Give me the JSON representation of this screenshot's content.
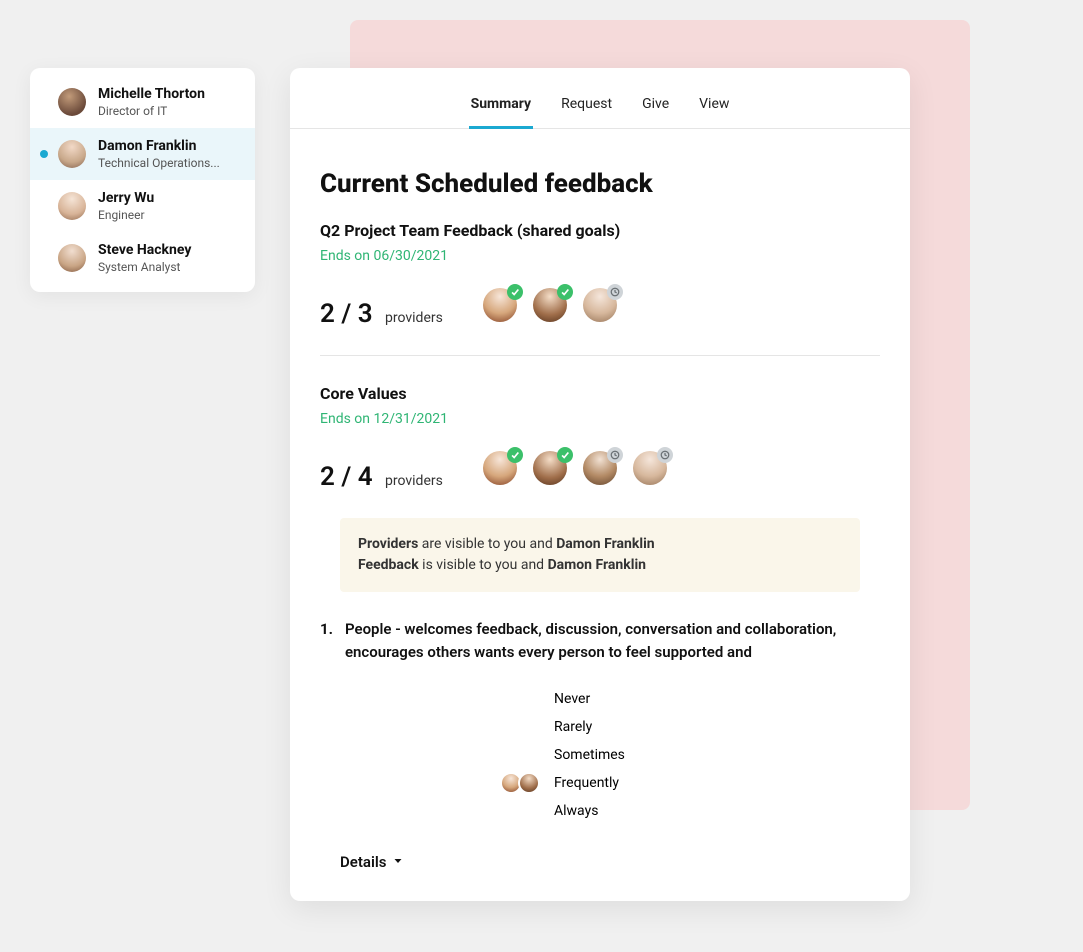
{
  "sidebar": {
    "people": [
      {
        "name": "Michelle Thorton",
        "role": "Director of IT",
        "active": false
      },
      {
        "name": "Damon Franklin",
        "role": "Technical Operations...",
        "active": true
      },
      {
        "name": "Jerry Wu",
        "role": "Engineer",
        "active": false
      },
      {
        "name": "Steve Hackney",
        "role": "System Analyst",
        "active": false
      }
    ]
  },
  "tabs": [
    {
      "label": "Summary",
      "active": true
    },
    {
      "label": "Request",
      "active": false
    },
    {
      "label": "Give",
      "active": false
    },
    {
      "label": "View",
      "active": false
    }
  ],
  "page_title": "Current Scheduled feedback",
  "sections": [
    {
      "title": "Q2 Project Team Feedback (shared goals)",
      "ends": "Ends on 06/30/2021",
      "completed": "2",
      "total": "3",
      "unit": "providers",
      "providers": [
        {
          "status": "done"
        },
        {
          "status": "done"
        },
        {
          "status": "pending"
        }
      ]
    },
    {
      "title": "Core Values",
      "ends": "Ends on 12/31/2021",
      "completed": "2",
      "total": "4",
      "unit": "providers",
      "providers": [
        {
          "status": "done"
        },
        {
          "status": "done"
        },
        {
          "status": "pending"
        },
        {
          "status": "pending"
        }
      ]
    }
  ],
  "notice": {
    "l1a": "Providers",
    "l1b": " are visible to you and ",
    "l1c": "Damon Franklin",
    "l2a": "Feedback",
    "l2b": " is visible to you and ",
    "l2c": "Damon Franklin"
  },
  "question": {
    "num": "1.",
    "text": "People - welcomes feedback, discussion, conversation and collaboration, encourages others  wants every person to feel supported and"
  },
  "options": [
    "Never",
    "Rarely",
    "Sometimes",
    "Frequently",
    "Always"
  ],
  "details_label": "Details"
}
